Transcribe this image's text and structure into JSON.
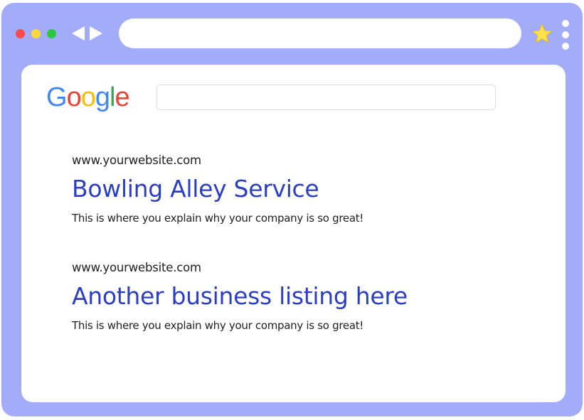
{
  "browser": {
    "frame_color": "#a3acf8",
    "window_controls": [
      {
        "name": "close-dot",
        "color": "#ff4b4b"
      },
      {
        "name": "minimize-dot",
        "color": "#ffd93b"
      },
      {
        "name": "maximize-dot",
        "color": "#27c93f"
      }
    ],
    "icons": {
      "back": "back-arrow-icon",
      "forward": "forward-arrow-icon",
      "bookmark": "star-icon",
      "menu": "kebab-menu-icon"
    },
    "address_bar": {
      "value": ""
    }
  },
  "search_page": {
    "logo": {
      "text": "Google",
      "letter_colors": [
        "#4285f4",
        "#ea4335",
        "#fbbc05",
        "#4285f4",
        "#34a853",
        "#ea4335"
      ]
    },
    "search_input": {
      "value": ""
    },
    "link_color": "#2b3ec4",
    "results": [
      {
        "url": "www.yourwebsite.com",
        "title": "Bowling Alley Service",
        "description": "This is where you explain why your company is so great!"
      },
      {
        "url": "www.yourwebsite.com",
        "title": "Another business listing here",
        "description": "This is where you explain why your company is so great!"
      }
    ]
  }
}
